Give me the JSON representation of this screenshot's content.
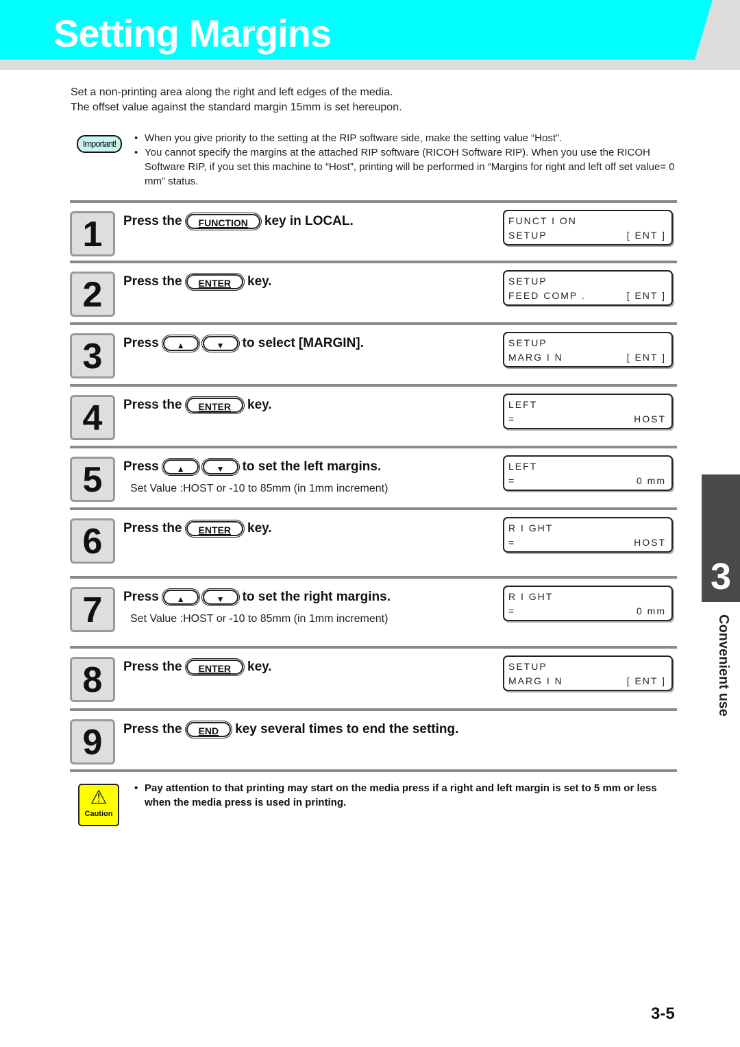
{
  "header": {
    "title": "Setting Margins",
    "banner_color": "#00ffff"
  },
  "intro": [
    "Set a non-printing area along the right and left edges of the media.",
    "The offset value against the standard margin 15mm is set hereupon."
  ],
  "important": {
    "badge": "Important!",
    "items": [
      "When you give priority to the setting at the RIP software side, make the setting value “Host”.",
      "You cannot specify the margins at the attached RIP software (RICOH Software RIP). When you use the RICOH Software RIP, if you set this machine to “Host”, printing will be performed in “Margins for right and left off set value= 0 mm” status."
    ]
  },
  "steps": [
    {
      "num": "1",
      "pre": "Press the",
      "keys": [
        "FUNCTION"
      ],
      "post": "key in LOCAL.",
      "lcd": {
        "line1": "FUNCT I ON",
        "line2": "SETUP",
        "right2": "[ ENT ]"
      }
    },
    {
      "num": "2",
      "pre": "Press the",
      "keys": [
        "ENTER"
      ],
      "post": "key.",
      "lcd": {
        "line1": "SETUP",
        "line2": "FEED  COMP .",
        "right2": "[ ENT ]"
      }
    },
    {
      "num": "3",
      "pre": "Press",
      "keys": [
        "▲",
        "▼"
      ],
      "post": "to select [MARGIN].",
      "lcd": {
        "line1": "SETUP",
        "line2": "MARG I N",
        "right2": "[ ENT ]"
      }
    },
    {
      "num": "4",
      "pre": "Press the",
      "keys": [
        "ENTER"
      ],
      "post": "key.",
      "lcd": {
        "line1": "LEFT",
        "line2": "=",
        "right2": "HOST"
      }
    },
    {
      "num": "5",
      "pre": "Press",
      "keys": [
        "▲",
        "▼"
      ],
      "post": "to set the left margins.",
      "sub": "Set Value :HOST or -10 to 85mm (in 1mm increment)",
      "lcd": {
        "line1": "LEFT",
        "line2": "=",
        "right2": "0 mm"
      }
    },
    {
      "num": "6",
      "pre": "Press the",
      "keys": [
        "ENTER"
      ],
      "post": "key.",
      "lcd": {
        "line1": "R I GHT",
        "line2": "=",
        "right2": "HOST"
      }
    },
    {
      "num": "7",
      "pre": "Press",
      "keys": [
        "▲",
        "▼"
      ],
      "post": "to set the right margins.",
      "sub": "Set Value :HOST or -10 to 85mm (in 1mm increment)",
      "lcd": {
        "line1": "R I GHT",
        "line2": "=",
        "right2": "0 mm"
      }
    },
    {
      "num": "8",
      "pre": "Press the",
      "keys": [
        "ENTER"
      ],
      "post": "key.",
      "lcd": {
        "line1": "SETUP",
        "line2": "MARG I N",
        "right2": "[ ENT ]"
      }
    },
    {
      "num": "9",
      "pre": "Press the",
      "keys": [
        "END"
      ],
      "post": "key several times to end the setting."
    }
  ],
  "caution": {
    "badge": "Caution",
    "items": [
      "Pay attention to that printing may start on the media press if a right and left margin is set to 5 mm or less when the media press is used in printing."
    ]
  },
  "chapter_tab": {
    "number": "3",
    "label": "Convenient use"
  },
  "page_number": "3-5"
}
